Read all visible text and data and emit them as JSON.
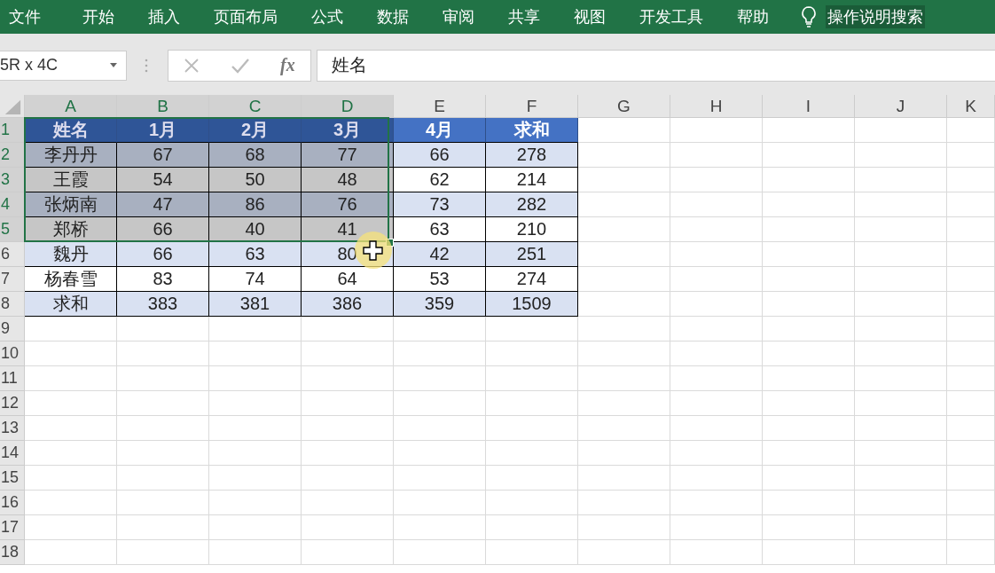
{
  "ribbon_tabs": [
    {
      "label": "文件"
    },
    {
      "label": "开始"
    },
    {
      "label": "插入"
    },
    {
      "label": "页面布局"
    },
    {
      "label": "公式"
    },
    {
      "label": "数据"
    },
    {
      "label": "审阅"
    },
    {
      "label": "共享"
    },
    {
      "label": "视图"
    },
    {
      "label": "开发工具"
    },
    {
      "label": "帮助"
    }
  ],
  "tell_me": {
    "label": "操作说明搜索"
  },
  "name_box": {
    "value": "5R x 4C"
  },
  "formula_bar": {
    "fx": "fx",
    "value": "姓名"
  },
  "columns": [
    {
      "label": "A",
      "selected": true
    },
    {
      "label": "B",
      "selected": true
    },
    {
      "label": "C",
      "selected": true
    },
    {
      "label": "D",
      "selected": true
    },
    {
      "label": "E",
      "selected": false
    },
    {
      "label": "F",
      "selected": false
    },
    {
      "label": "G",
      "selected": false
    },
    {
      "label": "H",
      "selected": false
    },
    {
      "label": "I",
      "selected": false
    },
    {
      "label": "J",
      "selected": false
    },
    {
      "label": "K",
      "selected": false
    }
  ],
  "row_numbers": [
    {
      "label": "1",
      "selected": true
    },
    {
      "label": "2",
      "selected": true
    },
    {
      "label": "3",
      "selected": true
    },
    {
      "label": "4",
      "selected": true
    },
    {
      "label": "5",
      "selected": true
    },
    {
      "label": "6",
      "selected": false
    },
    {
      "label": "7",
      "selected": false
    },
    {
      "label": "8",
      "selected": false
    },
    {
      "label": "9",
      "selected": false
    },
    {
      "label": "10",
      "selected": false
    },
    {
      "label": "11",
      "selected": false
    },
    {
      "label": "12",
      "selected": false
    },
    {
      "label": "13",
      "selected": false
    },
    {
      "label": "14",
      "selected": false
    },
    {
      "label": "15",
      "selected": false
    },
    {
      "label": "16",
      "selected": false
    },
    {
      "label": "17",
      "selected": false
    },
    {
      "label": "18",
      "selected": false
    }
  ],
  "table": {
    "rows": [
      {
        "kind": "header",
        "cells": [
          {
            "text": "姓名",
            "selected": true
          },
          {
            "text": "1月",
            "selected": true
          },
          {
            "text": "2月",
            "selected": true
          },
          {
            "text": "3月",
            "selected": true
          },
          {
            "text": "4月",
            "selected": false
          },
          {
            "text": "求和",
            "selected": false
          }
        ]
      },
      {
        "kind": "banded",
        "cells": [
          {
            "text": "李丹丹",
            "selected": true
          },
          {
            "text": "67",
            "selected": true
          },
          {
            "text": "68",
            "selected": true
          },
          {
            "text": "77",
            "selected": true
          },
          {
            "text": "66",
            "selected": false
          },
          {
            "text": "278",
            "selected": false
          }
        ]
      },
      {
        "kind": "plain",
        "cells": [
          {
            "text": "王霞",
            "selected": true
          },
          {
            "text": "54",
            "selected": true
          },
          {
            "text": "50",
            "selected": true
          },
          {
            "text": "48",
            "selected": true
          },
          {
            "text": "62",
            "selected": false
          },
          {
            "text": "214",
            "selected": false
          }
        ]
      },
      {
        "kind": "banded",
        "cells": [
          {
            "text": "张炳南",
            "selected": true
          },
          {
            "text": "47",
            "selected": true
          },
          {
            "text": "86",
            "selected": true
          },
          {
            "text": "76",
            "selected": true
          },
          {
            "text": "73",
            "selected": false
          },
          {
            "text": "282",
            "selected": false
          }
        ]
      },
      {
        "kind": "plain",
        "cells": [
          {
            "text": "郑桥",
            "selected": true
          },
          {
            "text": "66",
            "selected": true
          },
          {
            "text": "40",
            "selected": true
          },
          {
            "text": "41",
            "selected": true
          },
          {
            "text": "63",
            "selected": false
          },
          {
            "text": "210",
            "selected": false
          }
        ]
      },
      {
        "kind": "banded",
        "cells": [
          {
            "text": "魏丹",
            "selected": false
          },
          {
            "text": "66",
            "selected": false
          },
          {
            "text": "63",
            "selected": false
          },
          {
            "text": "80",
            "selected": false
          },
          {
            "text": "42",
            "selected": false
          },
          {
            "text": "251",
            "selected": false
          }
        ]
      },
      {
        "kind": "plain",
        "cells": [
          {
            "text": "杨春雪",
            "selected": false
          },
          {
            "text": "83",
            "selected": false
          },
          {
            "text": "74",
            "selected": false
          },
          {
            "text": "64",
            "selected": false
          },
          {
            "text": "53",
            "selected": false
          },
          {
            "text": "274",
            "selected": false
          }
        ]
      },
      {
        "kind": "banded",
        "cells": [
          {
            "text": "求和",
            "selected": false
          },
          {
            "text": "383",
            "selected": false
          },
          {
            "text": "381",
            "selected": false
          },
          {
            "text": "386",
            "selected": false
          },
          {
            "text": "359",
            "selected": false
          },
          {
            "text": "1509",
            "selected": false
          }
        ]
      }
    ]
  }
}
